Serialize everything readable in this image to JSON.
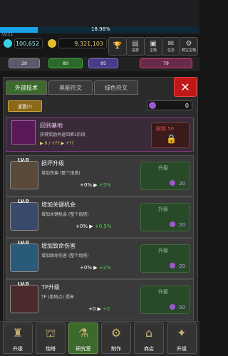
{
  "header": {
    "level": "LV.11",
    "progress_percent": "18.96%",
    "progress_fraction": 0.1896,
    "gems": "100,652",
    "coins": "9,321,103",
    "menu_buttons": [
      {
        "label": "",
        "icon": "trophy-icon"
      },
      {
        "label": "提要",
        "icon": "scroll-icon"
      },
      {
        "label": "宝箱",
        "icon": "chest-icon"
      },
      {
        "label": "任务",
        "icon": "quest-icon"
      },
      {
        "label": "藏宝宝箱",
        "icon": "treasure-icon"
      }
    ]
  },
  "status_strip": {
    "counters": [
      "29",
      "80",
      "95",
      "79"
    ]
  },
  "tabs": [
    {
      "label": "外部技术",
      "active": true
    },
    {
      "label": "黑能符文",
      "active": false
    },
    {
      "label": "绿色符文",
      "active": false
    }
  ],
  "controls": {
    "reset_label": "重置(?)",
    "gem_count": "0"
  },
  "base_card": {
    "title": "回到基地",
    "desc": "获得奖励并返回第1阶段",
    "note": "▶ 0 / +?? ▶ +??",
    "lock_label": "解锁 50"
  },
  "skills": [
    {
      "level": "LV.0",
      "title": "损坏升级",
      "desc": "增加伤害 (整个炮塔)",
      "value": "+0%",
      "plus": "+5%",
      "up_label": "升级",
      "cost": "20"
    },
    {
      "level": "LV.0",
      "title": "增加关键机会",
      "desc": "增加关键机会 (整个炮塔)",
      "value": "+0%",
      "plus": "+0.5%",
      "up_label": "升级",
      "cost": "20"
    },
    {
      "level": "LV.0",
      "title": "增加致命伤害",
      "desc": "增加致命伤害 (整个炮塔)",
      "value": "+0%",
      "plus": "+2%",
      "up_label": "升级",
      "cost": "20"
    },
    {
      "level": "LV.0",
      "title": "TP升级",
      "desc": "TP (炮塔点) 提高",
      "value": "+0",
      "plus": "+2",
      "up_label": "升级",
      "cost": "50"
    }
  ],
  "bottom_nav": [
    {
      "label": "升级",
      "icon": "turret-icon"
    },
    {
      "label": "炮塔",
      "icon": "cannon-icon"
    },
    {
      "label": "研究室",
      "icon": "flask-icon"
    },
    {
      "label": "制作",
      "icon": "gear-icon"
    },
    {
      "label": "商店",
      "icon": "shop-icon"
    },
    {
      "label": "升级",
      "icon": "map-icon"
    }
  ],
  "colors": {
    "accent_green": "#4cd24c",
    "close_red": "#c01818",
    "gem_purple": "#9b59d0",
    "level_blue": "#19a3e8"
  }
}
